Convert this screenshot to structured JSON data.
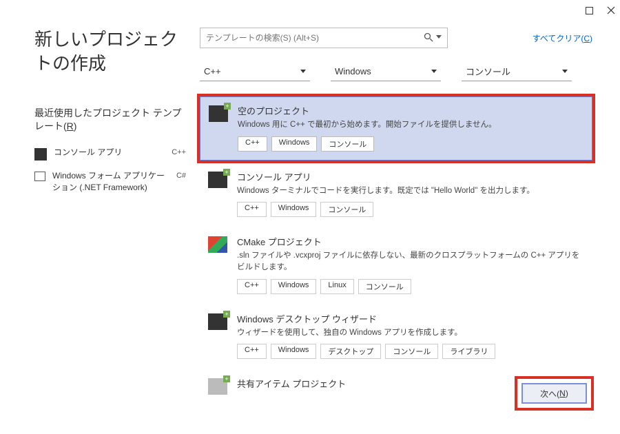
{
  "window": {
    "maximize_icon": "maximize",
    "close_icon": "close"
  },
  "main_title": "新しいプロジェクトの作成",
  "recent_heading": "最近使用したプロジェクト テンプレート(R)",
  "recent_items": [
    {
      "label": "コンソール アプリ",
      "lang": "C++"
    },
    {
      "label": "Windows フォーム アプリケーション (.NET Framework)",
      "lang": "C#"
    }
  ],
  "search": {
    "placeholder": "テンプレートの検索(S) (Alt+S)"
  },
  "clear_all": "すべてクリア(C)",
  "filters": [
    {
      "label": "C++"
    },
    {
      "label": "Windows"
    },
    {
      "label": "コンソール"
    }
  ],
  "templates": [
    {
      "name": "空のプロジェクト",
      "desc": "Windows 用に C++ で最初から始めます。開始ファイルを提供しません。",
      "tags": [
        "C++",
        "Windows",
        "コンソール"
      ],
      "selected": true
    },
    {
      "name": "コンソール アプリ",
      "desc": "Windows ターミナルでコードを実行します。既定では \"Hello World\" を出力します。",
      "tags": [
        "C++",
        "Windows",
        "コンソール"
      ]
    },
    {
      "name": "CMake プロジェクト",
      "desc": ".sln ファイルや .vcxproj ファイルに依存しない、最新のクロスプラットフォームの C++ アプリをビルドします。",
      "tags": [
        "C++",
        "Windows",
        "Linux",
        "コンソール"
      ]
    },
    {
      "name": "Windows デスクトップ ウィザード",
      "desc": "ウィザードを使用して、独自の Windows アプリを作成します。",
      "tags": [
        "C++",
        "Windows",
        "デスクトップ",
        "コンソール",
        "ライブラリ"
      ]
    },
    {
      "name": "共有アイテム プロジェクト",
      "desc": "",
      "tags": []
    }
  ],
  "next_label": "次へ(N)"
}
